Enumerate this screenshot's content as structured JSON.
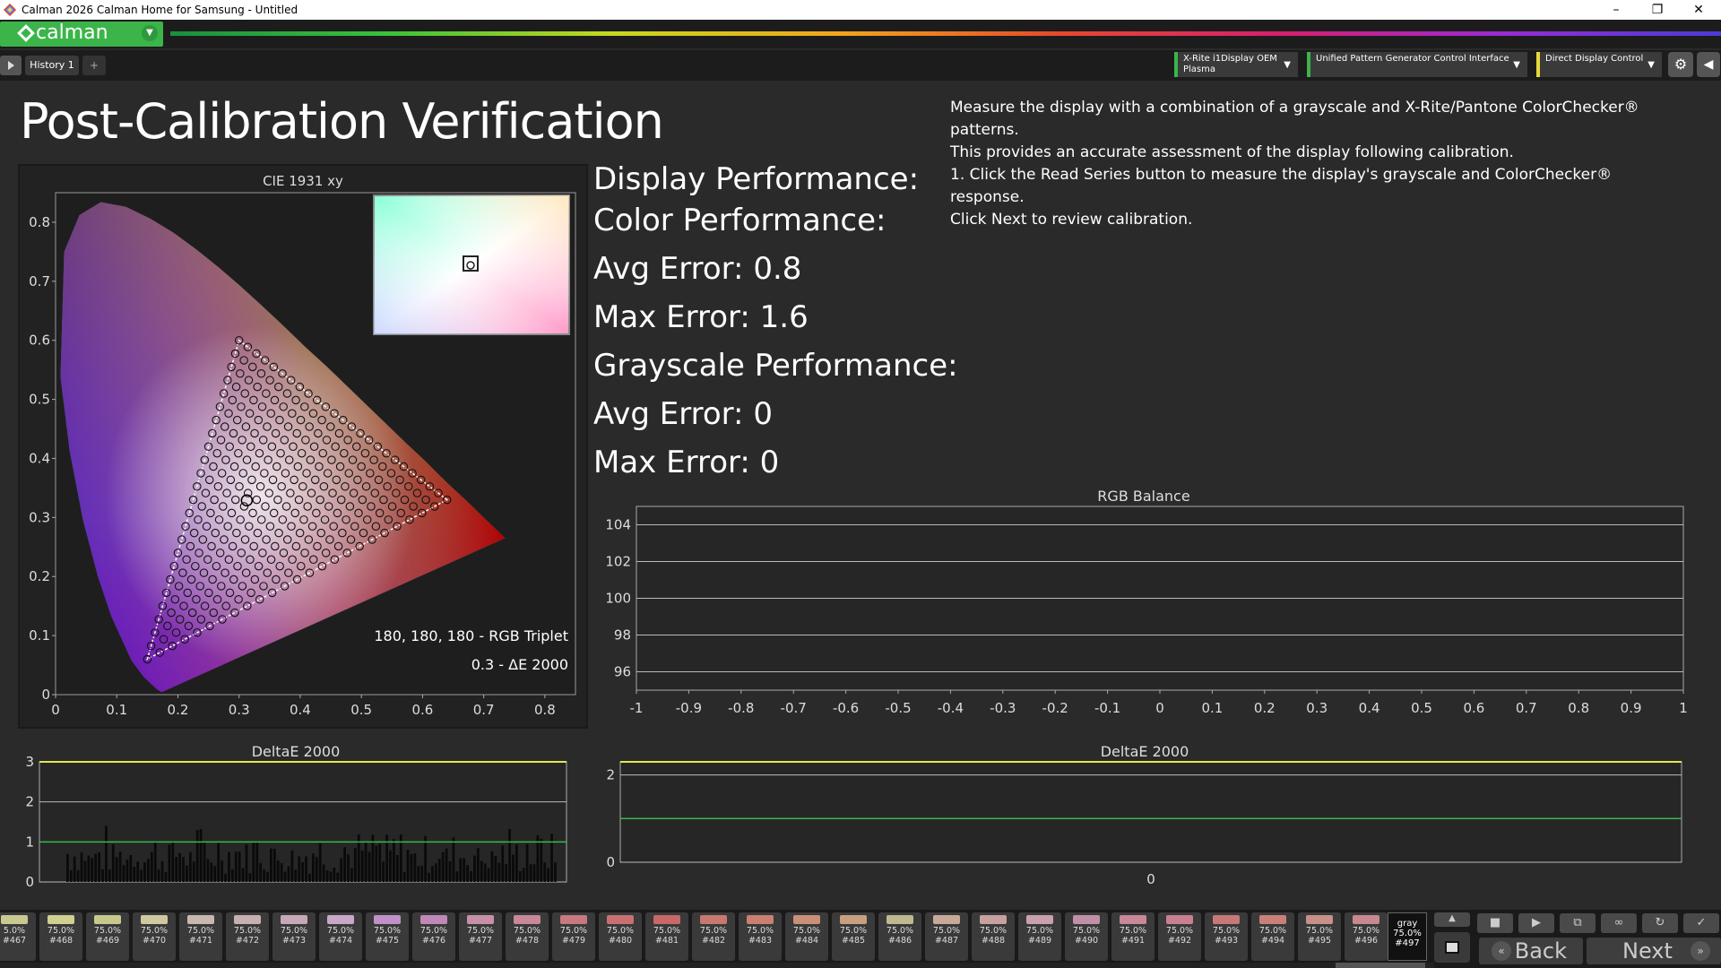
{
  "window": {
    "title": "Calman 2026 Calman Home for Samsung  - Untitled",
    "minimize": "–",
    "restore": "❐",
    "close": "✕"
  },
  "logo": {
    "text": "calman"
  },
  "tabs": [
    {
      "label": "History 1"
    }
  ],
  "tab_add": "+",
  "devices": [
    {
      "line1": "X-Rite i1Display OEM",
      "line2": "Plasma"
    },
    {
      "line1": "Unified Pattern Generator Control Interface",
      "line2": ""
    },
    {
      "line1": "Direct Display Control",
      "line2": ""
    }
  ],
  "page": {
    "title": "Post-Calibration Verification",
    "instructions": [
      "Measure the display with a combination of a grayscale and X-Rite/Pantone ColorChecker® patterns.",
      "This provides an accurate assessment of the display following calibration.",
      "1. Click the Read Series button to measure the display's grayscale and ColorChecker® response.",
      "Click Next to review calibration."
    ]
  },
  "performance": {
    "display_heading": "Display Performance:",
    "color_heading": "Color Performance:",
    "color_avg": "Avg Error: 0.8",
    "color_max": "Max Error: 1.6",
    "gray_heading": "Grayscale Performance:",
    "gray_avg": "Avg Error: 0",
    "gray_max": "Max Error: 0"
  },
  "chart_data": [
    {
      "type": "scatter",
      "title": "CIE 1931 xy",
      "xlim": [
        0,
        0.85
      ],
      "ylim": [
        0,
        0.85
      ],
      "xticks": [
        "0",
        "0.1",
        "0.2",
        "0.3",
        "0.4",
        "0.5",
        "0.6",
        "0.7",
        "0.8"
      ],
      "yticks": [
        "0",
        "0.1",
        "0.2",
        "0.3",
        "0.4",
        "0.5",
        "0.6",
        "0.7",
        "0.8"
      ],
      "gamut_triangle": {
        "red": [
          0.64,
          0.33
        ],
        "green": [
          0.3,
          0.6
        ],
        "blue": [
          0.15,
          0.06
        ]
      },
      "white_point": [
        0.3127,
        0.329
      ],
      "annotation_line1": "180, 180, 180 - RGB Triplet",
      "annotation_line2": "0.3 - ΔE 2000"
    },
    {
      "type": "line",
      "title": "RGB Balance",
      "xlim": [
        -1,
        1
      ],
      "ylim": [
        95,
        105
      ],
      "xticks": [
        "-1",
        "-0.9",
        "-0.8",
        "-0.7",
        "-0.6",
        "-0.5",
        "-0.4",
        "-0.3",
        "-0.2",
        "-0.1",
        "0",
        "0.1",
        "0.2",
        "0.3",
        "0.4",
        "0.5",
        "0.6",
        "0.7",
        "0.8",
        "0.9",
        "1"
      ],
      "yticks": [
        "96",
        "98",
        "100",
        "102",
        "104"
      ],
      "series": []
    },
    {
      "type": "bar",
      "title": "DeltaE 2000",
      "ylim": [
        0,
        3
      ],
      "yticks": [
        "0",
        "1",
        "2",
        "3"
      ],
      "threshold_lines": [
        1,
        3
      ],
      "bar_count": 140,
      "value_range": [
        0.2,
        1.5
      ]
    },
    {
      "type": "bar",
      "title": "DeltaE 2000",
      "ylim": [
        0,
        2.3
      ],
      "yticks": [
        "0",
        "2"
      ],
      "xticks": [
        "0"
      ],
      "threshold_lines": [
        1,
        2.3
      ],
      "values": [
        0
      ]
    }
  ],
  "swatches": [
    {
      "pct": "5.0%",
      "num": "#467",
      "color": "#c8c890"
    },
    {
      "pct": "75.0%",
      "num": "#468",
      "color": "#d0d090"
    },
    {
      "pct": "75.0%",
      "num": "#469",
      "color": "#c8c88c"
    },
    {
      "pct": "75.0%",
      "num": "#470",
      "color": "#d0c8a0"
    },
    {
      "pct": "75.0%",
      "num": "#471",
      "color": "#c8b8b0"
    },
    {
      "pct": "75.0%",
      "num": "#472",
      "color": "#c8b0b0"
    },
    {
      "pct": "75.0%",
      "num": "#473",
      "color": "#c8a8b8"
    },
    {
      "pct": "75.0%",
      "num": "#474",
      "color": "#c8a8c8"
    },
    {
      "pct": "75.0%",
      "num": "#475",
      "color": "#c090c8"
    },
    {
      "pct": "75.0%",
      "num": "#476",
      "color": "#c088b8"
    },
    {
      "pct": "75.0%",
      "num": "#477",
      "color": "#c890a8"
    },
    {
      "pct": "75.0%",
      "num": "#478",
      "color": "#c88898"
    },
    {
      "pct": "75.0%",
      "num": "#479",
      "color": "#c87880"
    },
    {
      "pct": "75.0%",
      "num": "#480",
      "color": "#c87070"
    },
    {
      "pct": "75.0%",
      "num": "#481",
      "color": "#c86868"
    },
    {
      "pct": "75.0%",
      "num": "#482",
      "color": "#c87870"
    },
    {
      "pct": "75.0%",
      "num": "#483",
      "color": "#c88070"
    },
    {
      "pct": "75.0%",
      "num": "#484",
      "color": "#c89078"
    },
    {
      "pct": "75.0%",
      "num": "#485",
      "color": "#c8a080"
    },
    {
      "pct": "75.0%",
      "num": "#486",
      "color": "#c0b890"
    },
    {
      "pct": "75.0%",
      "num": "#487",
      "color": "#c8a898"
    },
    {
      "pct": "75.0%",
      "num": "#488",
      "color": "#c8a0a0"
    },
    {
      "pct": "75.0%",
      "num": "#489",
      "color": "#c8a0b0"
    },
    {
      "pct": "75.0%",
      "num": "#490",
      "color": "#c090a8"
    },
    {
      "pct": "75.0%",
      "num": "#491",
      "color": "#c88898"
    },
    {
      "pct": "75.0%",
      "num": "#492",
      "color": "#c88090"
    },
    {
      "pct": "75.0%",
      "num": "#493",
      "color": "#c87878"
    },
    {
      "pct": "75.0%",
      "num": "#494",
      "color": "#c88078"
    },
    {
      "pct": "75.0%",
      "num": "#495",
      "color": "#c89088"
    },
    {
      "pct": "75.0%",
      "num": "#496",
      "color": "#c88890"
    }
  ],
  "selected_swatch": {
    "name": "gray",
    "pct": "75.0%",
    "num": "#497"
  },
  "nav": {
    "back": "Back",
    "next": "Next"
  },
  "colors": {
    "accent": "#3bb54a",
    "panel": "#222222",
    "grid": "#bbbbbb",
    "threshold_yellow": "#e6e650",
    "threshold_green": "#3bb54a"
  }
}
